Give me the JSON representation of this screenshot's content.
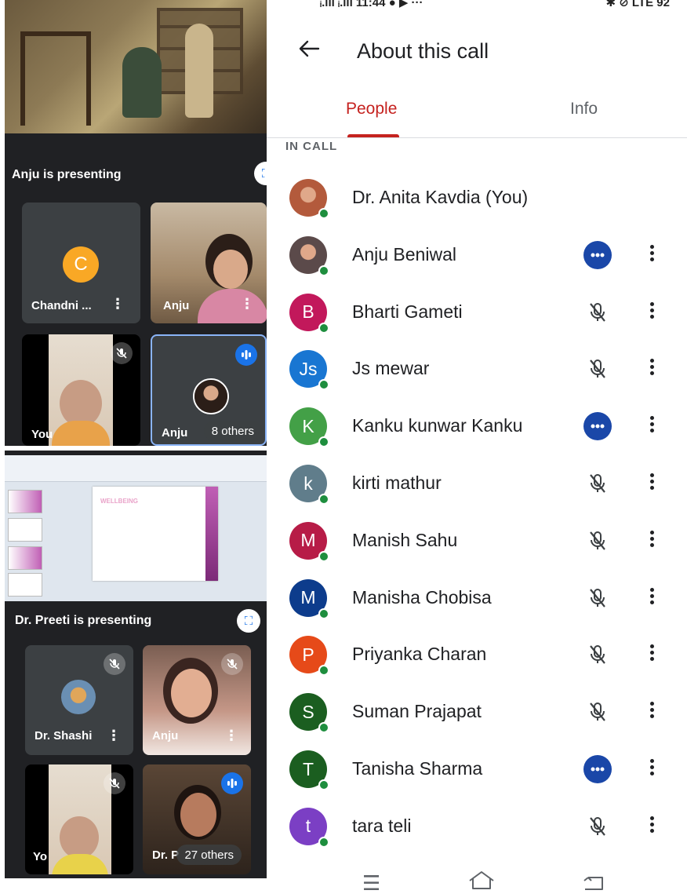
{
  "status_bar": {
    "left": "ᵢ.ııl ᵢ.ııl 11:44 ● ▶ ···",
    "right": "✱ ⊘ LTE 92"
  },
  "left": {
    "top_presenting": "Anju is presenting",
    "bottom_presenting": "Dr. Preeti is presenting",
    "top_tiles": {
      "chandni": {
        "initial": "C",
        "name": "Chandni ...",
        "color": "#f9a825"
      },
      "anju": {
        "name": "Anju"
      },
      "you": {
        "name": "You"
      },
      "anju_avatar": {
        "name": "Anju",
        "others": "8 others"
      }
    },
    "bottom_tiles": {
      "shashi": {
        "name": "Dr. Shashi"
      },
      "anju": {
        "name": "Anju"
      },
      "you": {
        "name": "Yo"
      },
      "preeti": {
        "name": "Dr. P",
        "others": "27 others"
      }
    },
    "slide": {
      "title": "WELLBEING"
    }
  },
  "header": {
    "title": "About this call"
  },
  "tabs": {
    "people": "People",
    "info": "Info"
  },
  "section": {
    "in_call": "IN CALL"
  },
  "people": [
    {
      "name": "Dr. Anita Kavdia (You)",
      "initial": "",
      "color": "#b35a3c",
      "photo": true,
      "status": "none"
    },
    {
      "name": "Anju Beniwal",
      "initial": "",
      "color": "#5b4a4a",
      "photo": true,
      "status": "speaking"
    },
    {
      "name": "Bharti Gameti",
      "initial": "B",
      "color": "#c2185b",
      "status": "muted"
    },
    {
      "name": "Js mewar",
      "initial": "Js",
      "color": "#1976d2",
      "status": "muted"
    },
    {
      "name": "Kanku kunwar Kanku",
      "initial": "K",
      "color": "#43a047",
      "status": "speaking"
    },
    {
      "name": "kirti mathur",
      "initial": "k",
      "color": "#607d8b",
      "status": "muted"
    },
    {
      "name": "Manish Sahu",
      "initial": "M",
      "color": "#b71c47",
      "status": "muted"
    },
    {
      "name": "Manisha Chobisa",
      "initial": "M",
      "color": "#0d3c8c",
      "status": "muted"
    },
    {
      "name": "Priyanka Charan",
      "initial": "P",
      "color": "#e64a19",
      "status": "muted"
    },
    {
      "name": "Suman Prajapat",
      "initial": "S",
      "color": "#1b5e20",
      "status": "muted"
    },
    {
      "name": "Tanisha Sharma",
      "initial": "T",
      "color": "#1b5e20",
      "status": "speaking"
    },
    {
      "name": "tara teli",
      "initial": "t",
      "color": "#7b3fc4",
      "status": "muted"
    }
  ],
  "colors": {
    "accent_red": "#c5221f",
    "speaking_blue": "#1a47a8",
    "online_green": "#1e8e3e"
  }
}
